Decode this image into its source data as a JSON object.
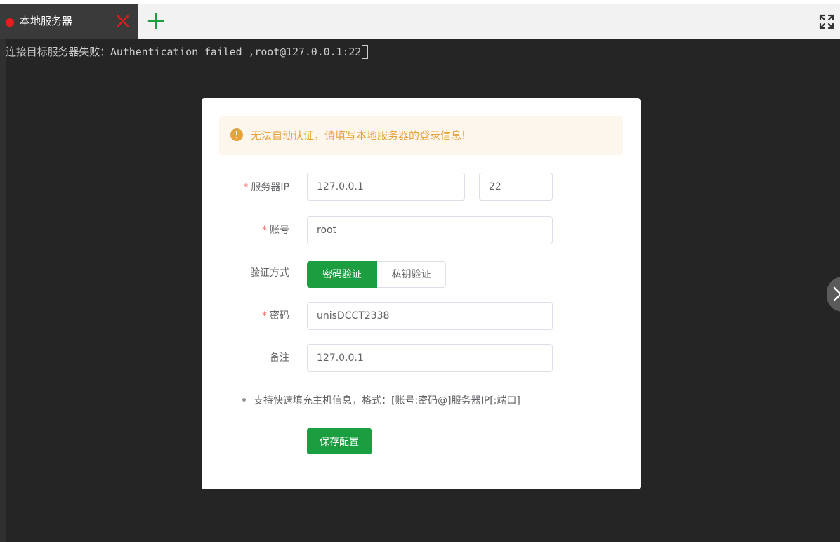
{
  "tabbar": {
    "tab": {
      "label": "本地服务器",
      "status_color": "#e81c1c"
    },
    "add_icon": "plus-icon",
    "fullscreen_icon": "fullscreen-icon"
  },
  "terminal": {
    "line": "连接目标服务器失败：Authentication failed ,root@127.0.0.1:22"
  },
  "dialog": {
    "alert": "无法自动认证，请填写本地服务器的登录信息!",
    "labels": {
      "server_ip": "服务器IP",
      "account": "账号",
      "auth_method": "验证方式",
      "password": "密码",
      "remark": "备注"
    },
    "required_mark": "*",
    "fields": {
      "server_ip": "127.0.0.1",
      "port": "22",
      "account": "root",
      "password": "unisDCCT2338",
      "remark": "127.0.0.1"
    },
    "auth_options": [
      "密码验证",
      "私钥验证"
    ],
    "auth_selected": "密码验证",
    "tip": "支持快速填充主机信息，格式：[账号:密码@]服务器IP[:端口]",
    "save_label": "保存配置"
  },
  "colors": {
    "accent_green": "#1a9e3f",
    "warning": "#e6a23c",
    "required": "#f56c6c",
    "terminal_bg": "#252525"
  }
}
